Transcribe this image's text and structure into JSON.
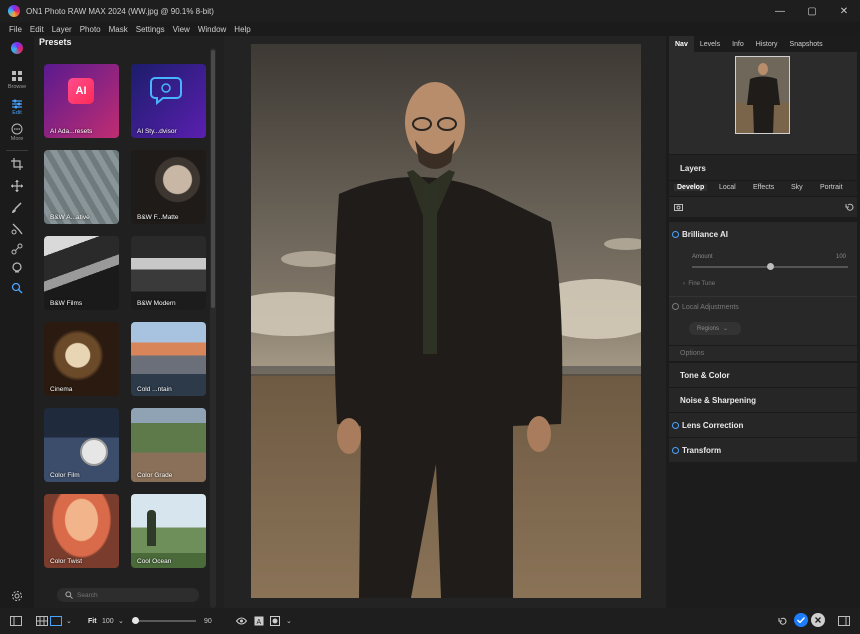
{
  "window": {
    "title": "ON1 Photo RAW MAX 2024 (WW.jpg @ 90.1% 8-bit)",
    "controls": [
      "—",
      "▢",
      "✕"
    ]
  },
  "menu": [
    "File",
    "Edit",
    "Layer",
    "Photo",
    "Mask",
    "Settings",
    "View",
    "Window",
    "Help"
  ],
  "toolrail": {
    "browse_label": "Browse",
    "edit_label": "Edit",
    "more_label": "More"
  },
  "presets": {
    "title": "Presets",
    "tiles": [
      {
        "label": "AI Ada...resets"
      },
      {
        "label": "AI Sty...dvisor"
      },
      {
        "label": "B&W A...ative"
      },
      {
        "label": "B&W F...Matte"
      },
      {
        "label": "B&W Films"
      },
      {
        "label": "B&W Modern"
      },
      {
        "label": "Cinema"
      },
      {
        "label": "Cold ...ntain"
      },
      {
        "label": "Color Film"
      },
      {
        "label": "Color Grade"
      },
      {
        "label": "Color Twist"
      },
      {
        "label": "Cool Ocean"
      }
    ],
    "search_placeholder": "Search"
  },
  "right": {
    "tabs": [
      "Nav",
      "Levels",
      "Info",
      "History",
      "Snapshots"
    ],
    "layers_title": "Layers",
    "develop_tabs": [
      "Develop",
      "Local",
      "Effects",
      "Sky",
      "Portrait"
    ],
    "brilliance": {
      "title": "Brilliance AI",
      "amount_label": "Amount",
      "amount_value": "100",
      "amount_fraction": 0.5,
      "fine_tune": "Fine Tune"
    },
    "local_adjustments": "Local Adjustments",
    "regions": "Regions",
    "options": "Options",
    "sections": [
      {
        "title": "Tone & Color",
        "ring": false
      },
      {
        "title": "Noise & Sharpening",
        "ring": false
      },
      {
        "title": "Lens Correction",
        "ring": true
      },
      {
        "title": "Transform",
        "ring": true
      }
    ]
  },
  "bottom": {
    "fit_label": "Fit",
    "zoom_value": "100",
    "zoom_right": "90",
    "zoom_fraction": 0.0
  },
  "colors": {
    "accent": "#4aa3ff",
    "confirm": "#1e7cff"
  }
}
